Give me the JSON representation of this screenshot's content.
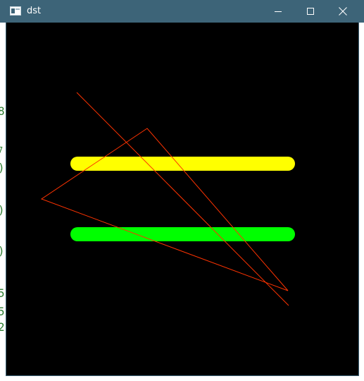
{
  "window": {
    "title": "dst",
    "minimize_icon": "minimize-icon",
    "maximize_icon": "maximize-icon",
    "close_icon": "close-icon",
    "app_icon": "window-app-icon"
  },
  "background_fragments": [
    ",",
    "⁠8",
    ",",
    "),",
    "),",
    "),",
    "5,",
    "5,",
    "2,"
  ],
  "canvas": {
    "background": "#000000",
    "shapes": [
      {
        "kind": "thick-line",
        "color": "#ffff00"
      },
      {
        "kind": "thick-line",
        "color": "#00ff00"
      },
      {
        "kind": "line",
        "color": "#ff3300"
      },
      {
        "kind": "triangle",
        "color": "#ff3300"
      }
    ]
  },
  "colors": {
    "titlebar": "#3d6478",
    "yellow": "#ffff00",
    "green": "#00ff00",
    "red": "#ff3300"
  }
}
